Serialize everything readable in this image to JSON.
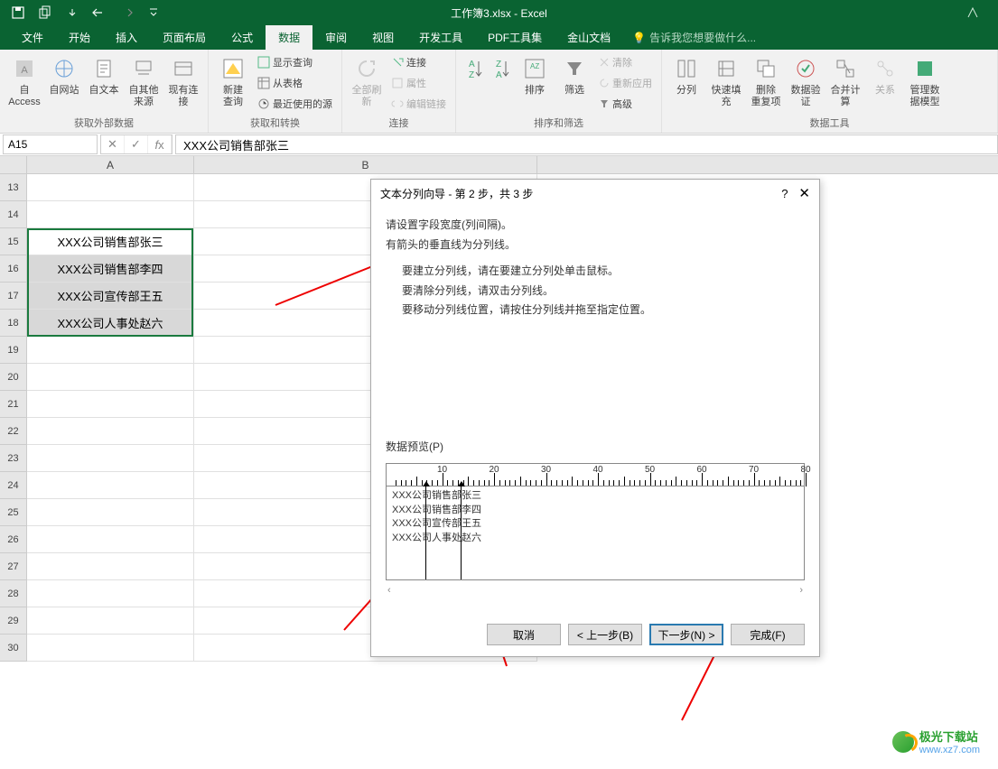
{
  "app": {
    "doc_name": "工作簿3.xlsx - Excel"
  },
  "tabs": {
    "file": "文件",
    "home": "开始",
    "insert": "插入",
    "layout": "页面布局",
    "formula": "公式",
    "data": "数据",
    "review": "审阅",
    "view": "视图",
    "dev": "开发工具",
    "pdf": "PDF工具集",
    "wps": "金山文档",
    "tellme": "告诉我您想要做什么..."
  },
  "ribbon": {
    "ext_data": {
      "access": "自 Access",
      "web": "自网站",
      "text": "自文本",
      "other": "自其他来源",
      "existing": "现有连接",
      "label": "获取外部数据"
    },
    "get_trans": {
      "new_query": "新建\n查询",
      "show_query": "显示查询",
      "from_table": "从表格",
      "recent": "最近使用的源",
      "label": "获取和转换"
    },
    "conn": {
      "refresh": "全部刷新",
      "connections": "连接",
      "properties": "属性",
      "edit_links": "编辑链接",
      "label": "连接"
    },
    "sort": {
      "sort": "排序",
      "filter": "筛选",
      "clear": "清除",
      "reapply": "重新应用",
      "advanced": "高级",
      "label": "排序和筛选"
    },
    "tools": {
      "text_to_col": "分列",
      "flash": "快速填充",
      "dedupe": "删除\n重复项",
      "validate": "数据验\n证",
      "consolidate": "合并计算",
      "relations": "关系",
      "model": "管理数\n据模型",
      "label": "数据工具"
    }
  },
  "formula_bar": {
    "cell_ref": "A15",
    "value": "XXX公司销售部张三"
  },
  "columns": [
    "A",
    "B"
  ],
  "rows": [
    13,
    14,
    15,
    16,
    17,
    18,
    19,
    20,
    21,
    22,
    23,
    24,
    25,
    26,
    27,
    28,
    29,
    30
  ],
  "cells": {
    "A15": "XXX公司销售部张三",
    "A16": "XXX公司销售部李四",
    "A17": "XXX公司宣传部王五",
    "A18": "XXX公司人事处赵六"
  },
  "dialog": {
    "title": "文本分列向导 - 第 2 步，共 3 步",
    "help": "?",
    "line1": "请设置字段宽度(列间隔)。",
    "line2": "有箭头的垂直线为分列线。",
    "inst1": "要建立分列线，请在要建立分列处单击鼠标。",
    "inst2": "要清除分列线，请双击分列线。",
    "inst3": "要移动分列线位置，请按住分列线并拖至指定位置。",
    "preview_label": "数据预览(P)",
    "preview_rows": [
      "XXX公司销售部张三",
      "XXX公司销售部李四",
      "XXX公司宣传部王五",
      "XXX公司人事处赵六"
    ],
    "ruler_marks": [
      10,
      20,
      30,
      40,
      50,
      60,
      70
    ],
    "btn_cancel": "取消",
    "btn_back": "< 上一步(B)",
    "btn_next": "下一步(N) >",
    "btn_finish": "完成(F)"
  },
  "watermark": {
    "text": "极光下载站",
    "url": "www.xz7.com"
  }
}
